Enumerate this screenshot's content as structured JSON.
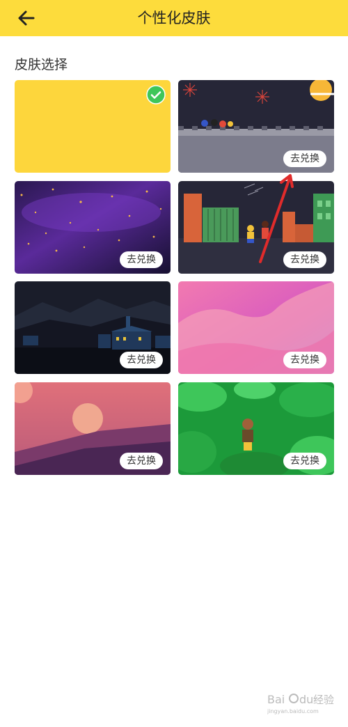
{
  "header": {
    "title": "个性化皮肤",
    "back_icon": "arrow-left-icon"
  },
  "section_title": "皮肤选择",
  "skins": [
    {
      "id": "yellow",
      "selected": true,
      "button_label": ""
    },
    {
      "id": "night-wall",
      "selected": false,
      "button_label": "去兑换"
    },
    {
      "id": "galaxy",
      "selected": false,
      "button_label": "去兑换"
    },
    {
      "id": "street-night",
      "selected": false,
      "button_label": "去兑换"
    },
    {
      "id": "night-village",
      "selected": false,
      "button_label": "去兑换"
    },
    {
      "id": "pink-gradient",
      "selected": false,
      "button_label": "去兑换"
    },
    {
      "id": "dusk-moon",
      "selected": false,
      "button_label": "去兑换"
    },
    {
      "id": "jungle",
      "selected": false,
      "button_label": "去兑换"
    }
  ],
  "colors": {
    "accent": "#fddc3c",
    "check": "#3ec65a",
    "annotation_arrow": "#e02b2b"
  },
  "watermark": {
    "text_cn": "经验",
    "text_sub": "jingyan.baidu.com",
    "brand": "Bai du"
  }
}
